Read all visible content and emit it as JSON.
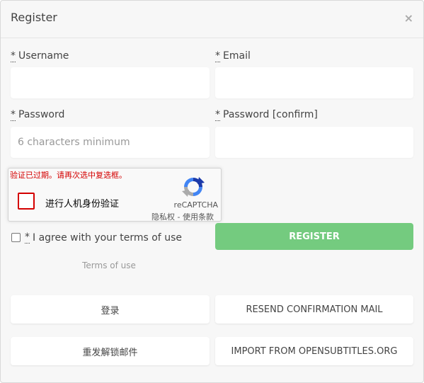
{
  "modal": {
    "title": "Register",
    "close_symbol": "×"
  },
  "form": {
    "required_mark": "*",
    "username": {
      "label": "Username",
      "value": "",
      "placeholder": ""
    },
    "email": {
      "label": "Email",
      "value": "",
      "placeholder": ""
    },
    "password": {
      "label": "Password",
      "value": "",
      "placeholder": "6 characters minimum"
    },
    "password_confirm": {
      "label": "Password [confirm]",
      "value": "",
      "placeholder": ""
    }
  },
  "recaptcha": {
    "error": "验证已过期。请再次选中复选框。",
    "label": "进行人机身份验证",
    "brand": "reCAPTCHA",
    "privacy": "隐私权",
    "separator": " - ",
    "terms": "使用条款",
    "icon": "recaptcha-logo-icon",
    "error_color": "#d40000"
  },
  "agree": {
    "text": "I agree with your terms of use",
    "checked": false
  },
  "terms_link": "Terms of use",
  "buttons": {
    "register": "REGISTER",
    "login": "登录",
    "resend": "RESEND CONFIRMATION MAIL",
    "resend_unlock": "重发解锁邮件",
    "import": "IMPORT FROM OPENSUBTITLES.ORG"
  },
  "colors": {
    "primary": "#74cb7f",
    "background": "#f7f7f7"
  }
}
